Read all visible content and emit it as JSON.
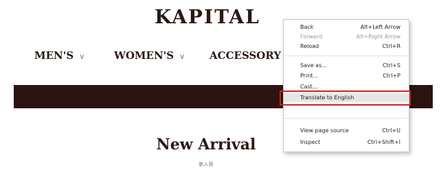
{
  "site": {
    "logo": "KAPITAL",
    "nav": [
      {
        "label": "MEN'S"
      },
      {
        "label": "WOMEN'S"
      },
      {
        "label": "ACCESSORY"
      }
    ],
    "section_title": "New Arrival",
    "section_subtitle": "新入荷"
  },
  "context_menu": {
    "items": [
      {
        "label": "Back",
        "shortcut": "Alt+Left Arrow",
        "enabled": true
      },
      {
        "label": "Forward",
        "shortcut": "Alt+Right Arrow",
        "enabled": false
      },
      {
        "label": "Reload",
        "shortcut": "Ctrl+R",
        "enabled": true
      },
      {
        "label": "Save as...",
        "shortcut": "Ctrl+S",
        "enabled": true
      },
      {
        "label": "Print...",
        "shortcut": "Ctrl+P",
        "enabled": true
      },
      {
        "label": "Cast...",
        "shortcut": "",
        "enabled": true
      },
      {
        "label": "Translate to English",
        "shortcut": "",
        "enabled": true,
        "highlighted": true
      },
      {
        "label": "View page source",
        "shortcut": "Ctrl+U",
        "enabled": true
      },
      {
        "label": "Inspect",
        "shortcut": "Ctrl+Shift+I",
        "enabled": true
      }
    ],
    "highlight_color": "#d81e1e"
  },
  "colors": {
    "brand_dark": "#2b1410",
    "text_dark": "#2a1914"
  },
  "icons": {
    "nav_chevron": "chevron-down-icon"
  }
}
